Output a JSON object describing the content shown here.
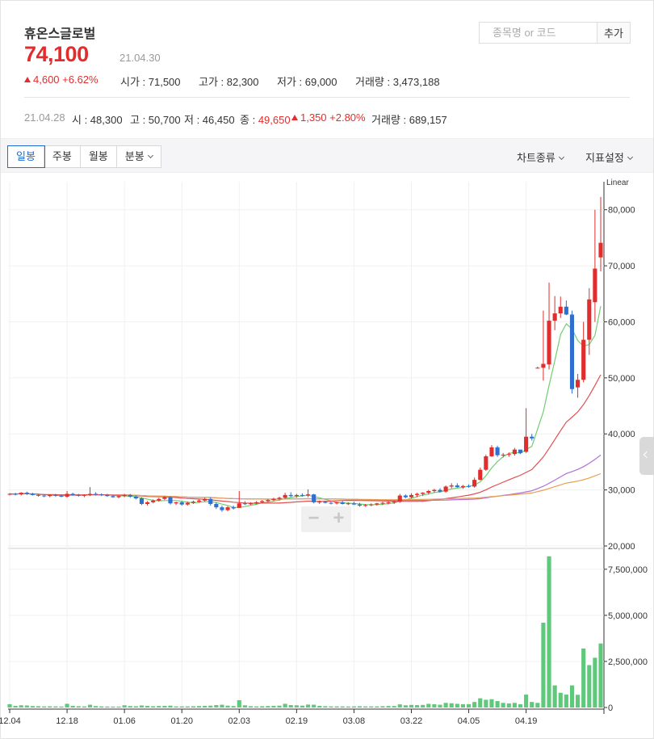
{
  "header": {
    "stock_name": "휴온스글로벌",
    "price": "74,100",
    "date": "21.04.30",
    "change": "4,600 +6.62%",
    "open": "시가 : 71,500",
    "high": "고가 : 82,300",
    "low": "저가 : 69,000",
    "volume": "거래량 : 3,473,188"
  },
  "search": {
    "placeholder": "종목명 or 코드",
    "add_label": "추가"
  },
  "previous": {
    "date": "21.04.28",
    "open": "시 : 48,300",
    "high": "고 : 50,700",
    "low": "저 : 46,450",
    "close_label": "종 :",
    "close_value": "49,650",
    "change": "1,350 +2.80%",
    "volume": "거래량 : 689,157"
  },
  "toolbar": {
    "tabs": [
      "일봉",
      "주봉",
      "월봉",
      "분봉"
    ],
    "active_tab": "일봉",
    "chart_type": "차트종류",
    "indicator": "지표설정"
  },
  "zoom": {
    "minus": "−",
    "plus": "+"
  },
  "colors": {
    "up": "#e12d2d",
    "down": "#2f6fd0",
    "volume": "#5ec87b",
    "ma5": "#6fcf6f",
    "ma20": "#e05050",
    "ma60": "#b070d8",
    "ma120": "#e8a050"
  },
  "chart_data": {
    "type": "candlestick",
    "scale": "Linear",
    "price_axis": {
      "ylim": [
        20000,
        85000
      ],
      "ticks": [
        20000,
        30000,
        40000,
        50000,
        60000,
        70000,
        80000
      ],
      "tick_labels": [
        "20,000",
        "30,000",
        "40,000",
        "50,000",
        "60,000",
        "70,000",
        "80,000"
      ]
    },
    "volume_axis": {
      "ylim": [
        0,
        8500000
      ],
      "ticks": [
        0,
        2500000,
        5000000,
        7500000
      ],
      "tick_labels": [
        "0",
        "2,500,000",
        "5,000,000",
        "7,500,000"
      ]
    },
    "x_tick_labels": [
      "12.04",
      "12.18",
      "01.06",
      "01.20",
      "02.03",
      "02.19",
      "03.08",
      "03.22",
      "04.05",
      "04.19"
    ],
    "x_tick_index": [
      0,
      10,
      20,
      30,
      40,
      50,
      60,
      70,
      80,
      90
    ],
    "candles": [
      [
        29200,
        29400,
        29000,
        29300,
        180000
      ],
      [
        29300,
        29500,
        29000,
        29200,
        90000
      ],
      [
        29200,
        29600,
        29000,
        29500,
        120000
      ],
      [
        29500,
        29700,
        29100,
        29300,
        110000
      ],
      [
        29300,
        29500,
        29000,
        29100,
        80000
      ],
      [
        29100,
        29300,
        28800,
        29000,
        70000
      ],
      [
        29000,
        29200,
        28700,
        28900,
        60000
      ],
      [
        28900,
        29200,
        28700,
        29100,
        65000
      ],
      [
        29100,
        29300,
        28800,
        29000,
        60000
      ],
      [
        29000,
        29200,
        28700,
        28800,
        55000
      ],
      [
        28800,
        29800,
        28600,
        29300,
        200000
      ],
      [
        29300,
        29500,
        29000,
        29100,
        90000
      ],
      [
        29100,
        29300,
        28800,
        29000,
        70000
      ],
      [
        29000,
        29200,
        28700,
        29100,
        60000
      ],
      [
        29100,
        30500,
        28900,
        29300,
        150000
      ],
      [
        29300,
        29600,
        29000,
        29200,
        80000
      ],
      [
        29200,
        29400,
        28900,
        29100,
        60000
      ],
      [
        29100,
        29300,
        28800,
        28900,
        55000
      ],
      [
        28900,
        29100,
        28600,
        28700,
        50000
      ],
      [
        28700,
        29000,
        28500,
        28900,
        50000
      ],
      [
        28900,
        29300,
        28700,
        29100,
        120000
      ],
      [
        29100,
        29300,
        28600,
        28800,
        80000
      ],
      [
        28800,
        29000,
        28300,
        28500,
        70000
      ],
      [
        28500,
        28700,
        27300,
        27500,
        110000
      ],
      [
        27500,
        28000,
        27200,
        27800,
        90000
      ],
      [
        27800,
        28300,
        27600,
        28100,
        70000
      ],
      [
        28100,
        28600,
        27900,
        28400,
        80000
      ],
      [
        28400,
        28900,
        28200,
        28700,
        90000
      ],
      [
        28700,
        28900,
        27400,
        27600,
        100000
      ],
      [
        27600,
        27900,
        27300,
        27800,
        60000
      ],
      [
        27800,
        28000,
        27200,
        27400,
        60000
      ],
      [
        27400,
        27900,
        27200,
        27700,
        60000
      ],
      [
        27700,
        28100,
        27500,
        27900,
        70000
      ],
      [
        27900,
        28300,
        27700,
        28100,
        80000
      ],
      [
        28100,
        28600,
        27900,
        28400,
        90000
      ],
      [
        28400,
        28700,
        27200,
        27500,
        100000
      ],
      [
        27500,
        27800,
        26600,
        26900,
        130000
      ],
      [
        26900,
        27200,
        26100,
        26400,
        150000
      ],
      [
        26400,
        27100,
        26200,
        26900,
        100000
      ],
      [
        26900,
        27200,
        26500,
        26700,
        80000
      ],
      [
        26800,
        29800,
        26800,
        27600,
        400000
      ],
      [
        27600,
        28000,
        27300,
        27500,
        120000
      ],
      [
        27500,
        27800,
        27300,
        27600,
        70000
      ],
      [
        27600,
        28000,
        27400,
        27800,
        60000
      ],
      [
        27800,
        28200,
        27600,
        28000,
        70000
      ],
      [
        28000,
        28400,
        27800,
        28200,
        80000
      ],
      [
        28200,
        28600,
        28000,
        28400,
        90000
      ],
      [
        28400,
        28800,
        28100,
        28600,
        100000
      ],
      [
        28600,
        29500,
        28400,
        29100,
        200000
      ],
      [
        29100,
        29600,
        28700,
        28900,
        130000
      ],
      [
        28900,
        29300,
        28600,
        29100,
        120000
      ],
      [
        29100,
        29400,
        28800,
        29000,
        100000
      ],
      [
        29000,
        30100,
        28700,
        29200,
        160000
      ],
      [
        29200,
        29300,
        27600,
        27800,
        150000
      ],
      [
        27800,
        28100,
        27500,
        27900,
        90000
      ],
      [
        27900,
        28100,
        27600,
        27700,
        70000
      ],
      [
        27700,
        27900,
        27400,
        27600,
        60000
      ],
      [
        27600,
        27900,
        27400,
        27800,
        60000
      ],
      [
        27800,
        28000,
        27400,
        27500,
        60000
      ],
      [
        27500,
        27800,
        27300,
        27600,
        55000
      ],
      [
        27600,
        27900,
        27300,
        27400,
        60000
      ],
      [
        27400,
        27700,
        27000,
        27200,
        70000
      ],
      [
        27200,
        27500,
        27000,
        27300,
        60000
      ],
      [
        27300,
        27600,
        27100,
        27400,
        60000
      ],
      [
        27400,
        27700,
        27200,
        27600,
        60000
      ],
      [
        27600,
        27900,
        27300,
        27700,
        70000
      ],
      [
        27700,
        28000,
        27400,
        27800,
        80000
      ],
      [
        27800,
        28100,
        27500,
        27900,
        80000
      ],
      [
        27900,
        29300,
        27700,
        29000,
        170000
      ],
      [
        29000,
        29200,
        28500,
        28700,
        120000
      ],
      [
        28700,
        29400,
        28500,
        29100,
        140000
      ],
      [
        29100,
        29500,
        28700,
        29300,
        130000
      ],
      [
        29300,
        29600,
        28900,
        29500,
        140000
      ],
      [
        29500,
        30000,
        29200,
        29800,
        200000
      ],
      [
        29800,
        30200,
        29500,
        30000,
        180000
      ],
      [
        30000,
        30300,
        29500,
        29700,
        150000
      ],
      [
        29700,
        30800,
        29500,
        30600,
        250000
      ],
      [
        30600,
        31200,
        30300,
        30800,
        230000
      ],
      [
        30800,
        31200,
        30400,
        30500,
        200000
      ],
      [
        30500,
        30900,
        30200,
        30700,
        180000
      ],
      [
        30700,
        31000,
        30400,
        30600,
        180000
      ],
      [
        30600,
        32200,
        30400,
        31800,
        300000
      ],
      [
        31800,
        34000,
        31700,
        33600,
        500000
      ],
      [
        33600,
        36300,
        33400,
        36000,
        420000
      ],
      [
        36000,
        38000,
        35900,
        37600,
        450000
      ],
      [
        37600,
        37900,
        35900,
        36200,
        350000
      ],
      [
        36200,
        36600,
        35800,
        36300,
        250000
      ],
      [
        36300,
        36700,
        35900,
        36400,
        220000
      ],
      [
        36400,
        37500,
        36100,
        37200,
        250000
      ],
      [
        37200,
        36900,
        36400,
        36600,
        180000
      ],
      [
        36800,
        44600,
        36600,
        39500,
        700000
      ],
      [
        39500,
        40000,
        38800,
        39200,
        300000
      ],
      [
        51800,
        52000,
        51700,
        51800,
        250000
      ],
      [
        51800,
        62000,
        49500,
        52500,
        4600000
      ],
      [
        52400,
        67000,
        51500,
        60200,
        8200000
      ],
      [
        60200,
        64600,
        58500,
        61500,
        1200000
      ],
      [
        61500,
        64500,
        60700,
        62700,
        800000
      ],
      [
        62700,
        63800,
        61200,
        61300,
        700000
      ],
      [
        61300,
        62000,
        47200,
        48000,
        1200000
      ],
      [
        48300,
        50700,
        46450,
        49650,
        689157
      ],
      [
        49650,
        60000,
        49200,
        56800,
        3200000
      ],
      [
        56800,
        66000,
        54100,
        64000,
        2300000
      ],
      [
        63500,
        80000,
        60000,
        69500,
        2700000
      ],
      [
        71500,
        82300,
        69000,
        74100,
        3473188
      ]
    ],
    "moving_averages": [
      {
        "period": 5,
        "color": "#6fcf6f"
      },
      {
        "period": 20,
        "color": "#e05050"
      },
      {
        "period": 60,
        "color": "#b070d8"
      },
      {
        "period": 120,
        "color": "#e8a050"
      }
    ]
  }
}
